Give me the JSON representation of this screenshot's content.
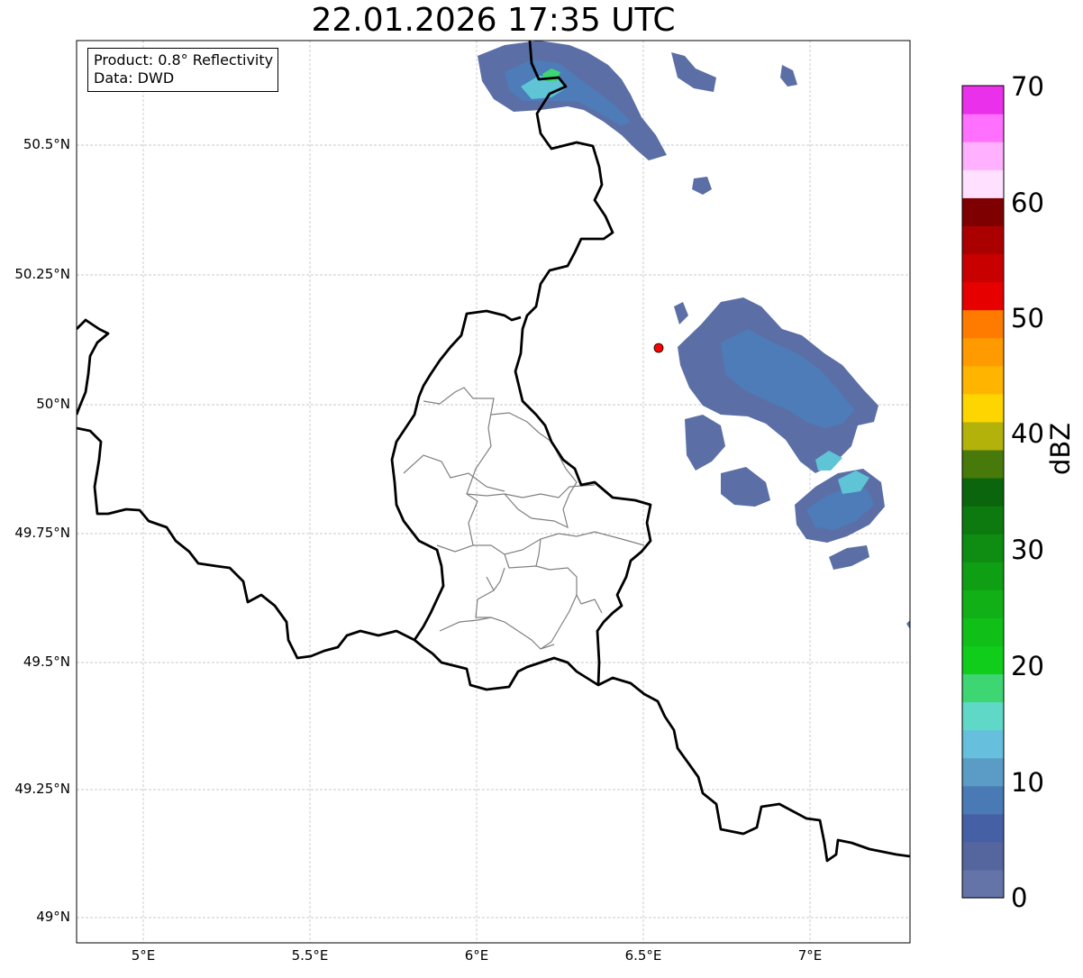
{
  "title": "22.01.2026 17:35 UTC",
  "info": {
    "product": "Product: 0.8° Reflectivity",
    "source": "Data: DWD"
  },
  "axes": {
    "lon_ticks": [
      "5°E",
      "5.5°E",
      "6°E",
      "6.5°E",
      "7°E"
    ],
    "lat_ticks": [
      "50.5°N",
      "50.25°N",
      "50°N",
      "49.75°N",
      "49.5°N",
      "49.25°N",
      "49°N"
    ],
    "lon_range": [
      4.8,
      7.3
    ],
    "lat_range": [
      48.95,
      50.7
    ],
    "grid": true
  },
  "colorbar": {
    "label": "dBZ",
    "ticks": [
      "0",
      "10",
      "20",
      "30",
      "40",
      "50",
      "60",
      "70"
    ],
    "range": [
      0,
      70
    ],
    "colors": [
      "#6473a8",
      "#55669f",
      "#4660a5",
      "#4a7ab5",
      "#5a9cc6",
      "#66bfdc",
      "#60d8c8",
      "#3dd672",
      "#10cc1b",
      "#10bf18",
      "#10b016",
      "#0f9f14",
      "#0e8d12",
      "#0c7a0f",
      "#0a650c",
      "#47790b",
      "#b2b20a",
      "#ffd500",
      "#ffb500",
      "#ff9a00",
      "#ff7b00",
      "#e60000",
      "#c80000",
      "#aa0000",
      "#7f0000",
      "#ffe0ff",
      "#ffb0ff",
      "#ff70ff",
      "#ea30ea"
    ]
  },
  "radar_site_color": "#ff0000",
  "echo_colors": {
    "light": "#5b6fa6",
    "medium": "#4d7cb8",
    "strong": "#5fc4d6",
    "peak": "#3dd672"
  }
}
